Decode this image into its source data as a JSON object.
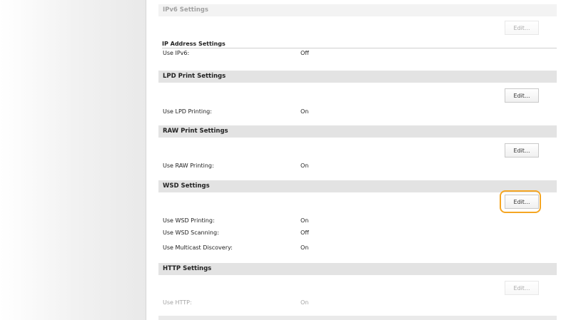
{
  "ipv6": {
    "header": "IPv6 Settings",
    "edit_label": "Edit...",
    "subheader": "IP Address Settings",
    "rows": [
      {
        "label": "Use IPv6:",
        "value": "Off"
      }
    ]
  },
  "lpd": {
    "header": "LPD Print Settings",
    "edit_label": "Edit...",
    "rows": [
      {
        "label": "Use LPD Printing:",
        "value": "On"
      }
    ]
  },
  "raw": {
    "header": "RAW Print Settings",
    "edit_label": "Edit...",
    "rows": [
      {
        "label": "Use RAW Printing:",
        "value": "On"
      }
    ]
  },
  "wsd": {
    "header": "WSD Settings",
    "edit_label": "Edit...",
    "rows": [
      {
        "label": "Use WSD Printing:",
        "value": "On"
      },
      {
        "label": "Use WSD Scanning:",
        "value": "Off"
      },
      {
        "label": "Use Multicast Discovery:",
        "value": "On"
      }
    ]
  },
  "http": {
    "header": "HTTP Settings",
    "edit_label": "Edit...",
    "rows": [
      {
        "label": "Use HTTP:",
        "value": "On"
      }
    ]
  },
  "colors": {
    "section_header_bg": "#e3e3e3",
    "highlight": "#f5a623"
  }
}
